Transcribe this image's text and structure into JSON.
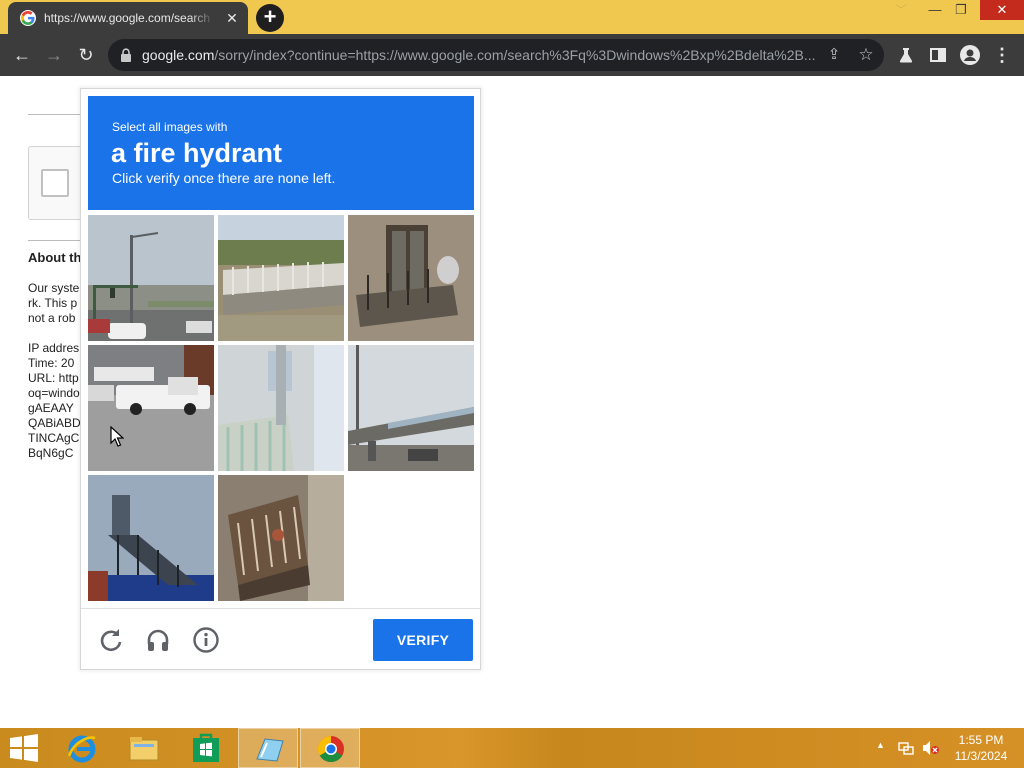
{
  "browser": {
    "tab": {
      "title": "https://www.google.com/search",
      "close_glyph": "✕"
    },
    "new_tab_glyph": "+",
    "window_controls": {
      "chevron": "﹀",
      "minimize": "—",
      "maximize": "❐",
      "close": "✕"
    },
    "nav": {
      "back_glyph": "←",
      "forward_glyph": "→",
      "reload_glyph": "↻"
    },
    "address_bar": {
      "host": "google.com",
      "path": "/sorry/index?continue=https://www.google.com/search%3Fq%3Dwindows%2Bxp%2Bdelta%2B..."
    },
    "toolbar_icons": [
      "share-icon",
      "bookmark-star-icon",
      "labs-flask-icon",
      "side-panel-icon",
      "profile-icon",
      "menu-icon"
    ]
  },
  "background_page": {
    "heading": "About th",
    "lines": [
      "Our syste",
      "rk. This p",
      "not a rob",
      "",
      "IP addres",
      "Time: 20",
      "URL: http",
      "oq=windo",
      "gAEAAY",
      "QABiABD",
      "TINCAgC",
      "BqN6gC"
    ]
  },
  "captcha": {
    "instruction_line1": "Select all images with",
    "target": "a fire hydrant",
    "instruction_line3": "Click verify once there are none left.",
    "tiles": [
      {
        "description": "intersection with traffic light poles and parked cars"
      },
      {
        "description": "bridge railing over water"
      },
      {
        "description": "building balcony with satellite dish"
      },
      {
        "description": "white pickup trucks in a parking lot"
      },
      {
        "description": "blurred railing"
      },
      {
        "description": "highway overpass"
      },
      {
        "description": "fire escape stairs on blue building"
      },
      {
        "description": "rusted balcony"
      },
      {
        "description": "empty (loading)"
      }
    ],
    "footer_icons": [
      "reload-icon",
      "audio-headphones-icon",
      "info-icon"
    ],
    "verify_label": "VERIFY"
  },
  "taskbar": {
    "apps": [
      "internet-explorer-icon",
      "file-explorer-icon",
      "store-icon",
      "paint-icon",
      "chrome-icon"
    ],
    "clock_time": "1:55 PM",
    "clock_date": "11/3/2024"
  },
  "colors": {
    "tab_strip": "#f0c84f",
    "chrome_dark": "#3c3c3c",
    "captcha_blue": "#1a73e8",
    "taskbar": "#d9962a"
  }
}
